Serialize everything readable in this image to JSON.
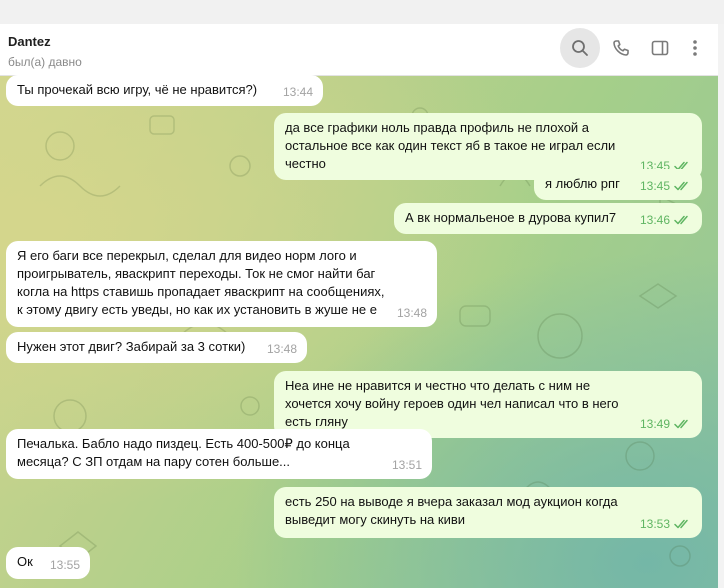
{
  "header": {
    "contact_name": "Dantez",
    "status": "был(а) давно",
    "icons": [
      "search-icon",
      "phone-icon",
      "sidebar-icon",
      "more-vertical-icon"
    ]
  },
  "colors": {
    "incoming_bubble": "#ffffff",
    "outgoing_bubble": "#effdde",
    "outgoing_time": "#5fb562",
    "incoming_time": "#a3a3a3"
  },
  "messages": [
    {
      "dir": "in",
      "text": "Ты прочекай всю игру, чё не нравится?)",
      "time": "13:44"
    },
    {
      "dir": "out",
      "text": "да все графики ноль правда профиль не плохой а остальное все как один текст яб в такое не играл если честно",
      "time": "13:45",
      "read": true
    },
    {
      "dir": "out",
      "text": "я люблю рпг",
      "time": "13:45",
      "read": true
    },
    {
      "dir": "out",
      "text": "А вк нормальеное в дурова купил7",
      "time": "13:46",
      "read": true
    },
    {
      "dir": "in",
      "text": "Я его баги все перекрыл, сделал для видео норм лого и проигрыватель, яваскрипт переходы. Ток не смог найти баг когла на https ставишь пропадает яваскрипт на сообщениях, к этому двигу есть уведы, но как их установить в жуше не е",
      "time": "13:48"
    },
    {
      "dir": "in",
      "text": "Нужен этот двиг? Забирай за 3 сотки)",
      "time": "13:48"
    },
    {
      "dir": "out",
      "text": "Неа ине не нравится и честно что делать с ним не хочется хочу войну героев один чел написал что в него есть гляну",
      "time": "13:49",
      "read": true
    },
    {
      "dir": "in",
      "text": "Печалька. Бабло надо пиздец. Есть 400-500₽ до конца месяца? С ЗП отдам на пару сотен больше...",
      "time": "13:51"
    },
    {
      "dir": "out",
      "text": "есть 250 на выводе я вчера заказал мод аукцион когда выведит могу скинуть  на киви",
      "time": "13:53",
      "read": true
    },
    {
      "dir": "in",
      "text": "Ок",
      "time": "13:55"
    }
  ]
}
